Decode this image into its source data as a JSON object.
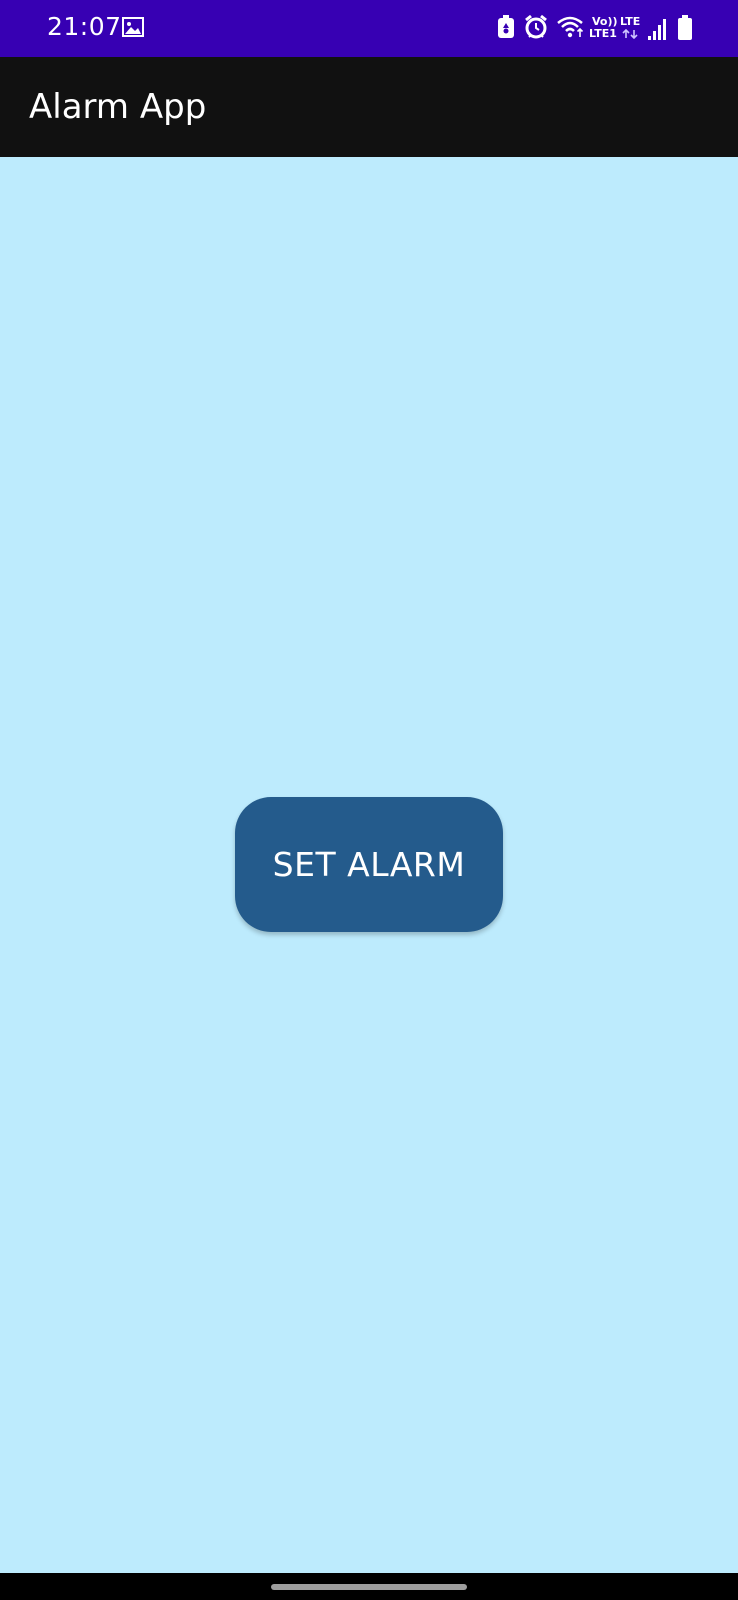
{
  "status_bar": {
    "time": "21:07",
    "net_volte": "Vo))",
    "net_lte1": "LTE1",
    "net_lte": "LTE",
    "icons": [
      "gallery-icon",
      "battery-saver-icon",
      "alarm-icon",
      "wifi-icon",
      "signal-icon",
      "battery-icon"
    ]
  },
  "app_bar": {
    "title": "Alarm App"
  },
  "main": {
    "button_label": "SET ALARM"
  },
  "colors": {
    "status_bar": "#3700B3",
    "app_bar": "#111111",
    "background": "#BDEBFD",
    "button": "#245B8C",
    "nav_bar": "#000000"
  }
}
